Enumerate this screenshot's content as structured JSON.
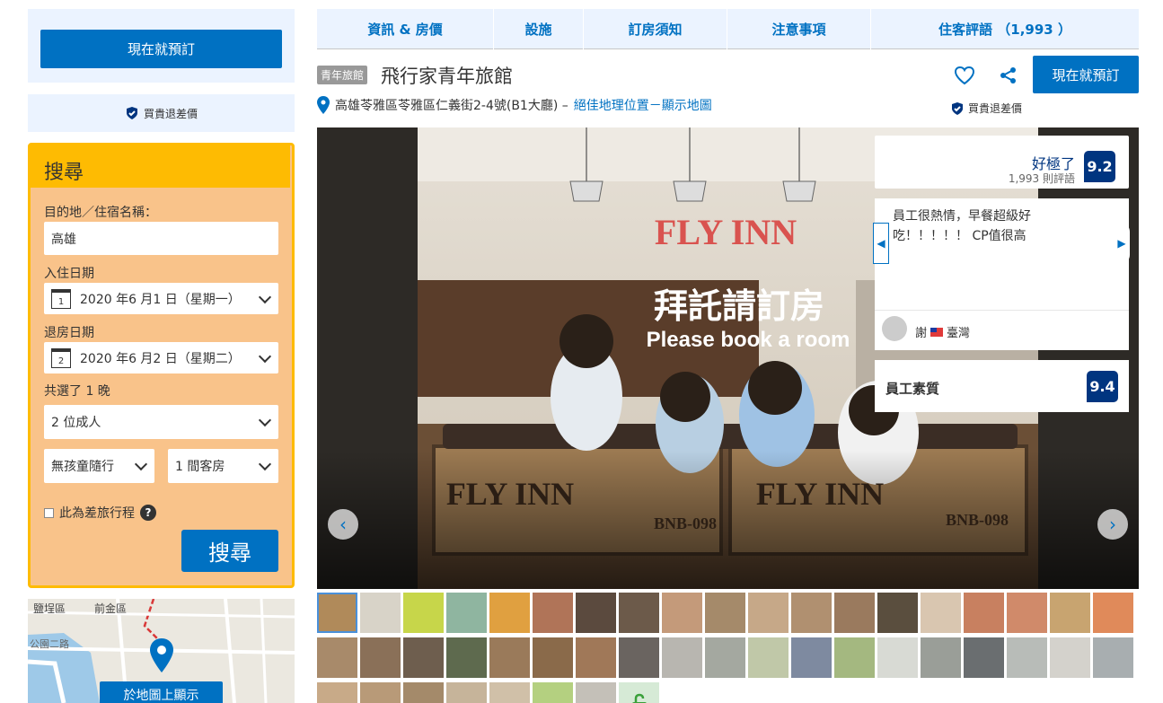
{
  "sidebar": {
    "book_now": "現在就預訂",
    "price_match": "買貴退差價",
    "search": {
      "heading": "搜尋",
      "dest_label": "目的地／住宿名稱：",
      "dest_value": "高雄",
      "checkin_label": "入住日期",
      "checkin_day": "1",
      "checkin_value": "2020 年6 月1 日（星期一）",
      "checkout_label": "退房日期",
      "checkout_day": "2",
      "checkout_value": "2020 年6 月2 日（星期二）",
      "nights": "共選了 1 晚",
      "adults": "2 位成人",
      "children": "無孩童隨行",
      "rooms": "1 間客房",
      "business_trip": "此為差旅行程",
      "help": "?",
      "submit": "搜尋"
    },
    "map": {
      "labels": [
        "鹽埕區",
        "前金區",
        "公園二路"
      ],
      "show_button": "於地圖上顯示"
    }
  },
  "tabs": [
    {
      "label": "資訊 & 房價"
    },
    {
      "label": "設施"
    },
    {
      "label": "訂房須知"
    },
    {
      "label": "注意事項"
    },
    {
      "label": "住客評語 （1,993 ）"
    }
  ],
  "property": {
    "type_badge": "青年旅館",
    "name": "飛行家青年旅館",
    "address": "高雄苓雅區苓雅區仁義街2-4號(B1大廳) –",
    "location_link": "絕佳地理位置－顯示地圖",
    "book_now": "現在就預訂",
    "price_match": "買貴退差價"
  },
  "photo": {
    "sign_text": "FLY INN",
    "overlay_zh": "拜託請訂房",
    "overlay_en": "Please book a room",
    "crate_left": "FLY INN",
    "crate_right": "FLY INN",
    "crate_code_left": "BNB-098",
    "crate_code_right": "BNB-098"
  },
  "rating": {
    "label": "好極了",
    "count": "1,993 則評語",
    "score": "9.2"
  },
  "review": {
    "text": "員工很熱情，早餐超級好吃！！！！！ CP值很高",
    "author": "謝",
    "country": "臺灣"
  },
  "staff": {
    "label": "員工素質",
    "score": "9.4"
  },
  "colors": {
    "brand_blue": "#0071c2",
    "dark_blue": "#003580",
    "search_yellow": "#febb02",
    "light_blue_bg": "#ebf3ff"
  }
}
